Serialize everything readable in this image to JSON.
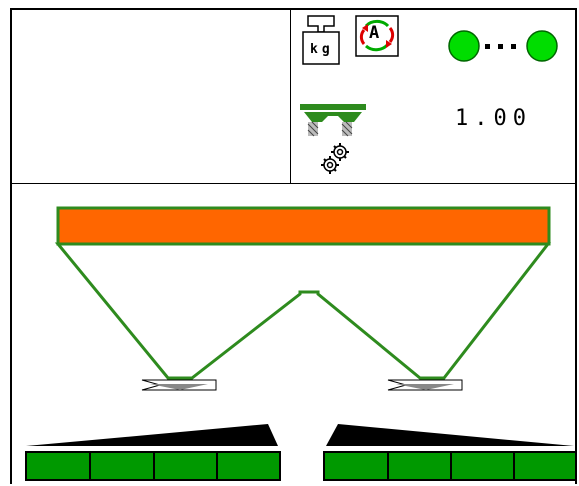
{
  "header": {
    "weigh_cell_icon": "weigh-cell-kg-icon",
    "weigh_unit_label": "kg",
    "auto_mode_icon": "automatic-mode-icon",
    "auto_mode_letter": "A",
    "section_status_icon": "boom-sections-status-icon",
    "spreader_icon": "spreader-metering-icon",
    "gears_icon": "gear-icon",
    "rate_factor": "1.00"
  },
  "hopper": {
    "fill_color": "#ff6600",
    "outline_color": "#2e8b1e",
    "hopper_icon": "hopper-icon"
  },
  "section_bars": {
    "color": "#009900",
    "left_segments": 4,
    "right_segments": 4
  },
  "colors": {
    "status_green": "#00dd00",
    "frame": "#000000"
  }
}
